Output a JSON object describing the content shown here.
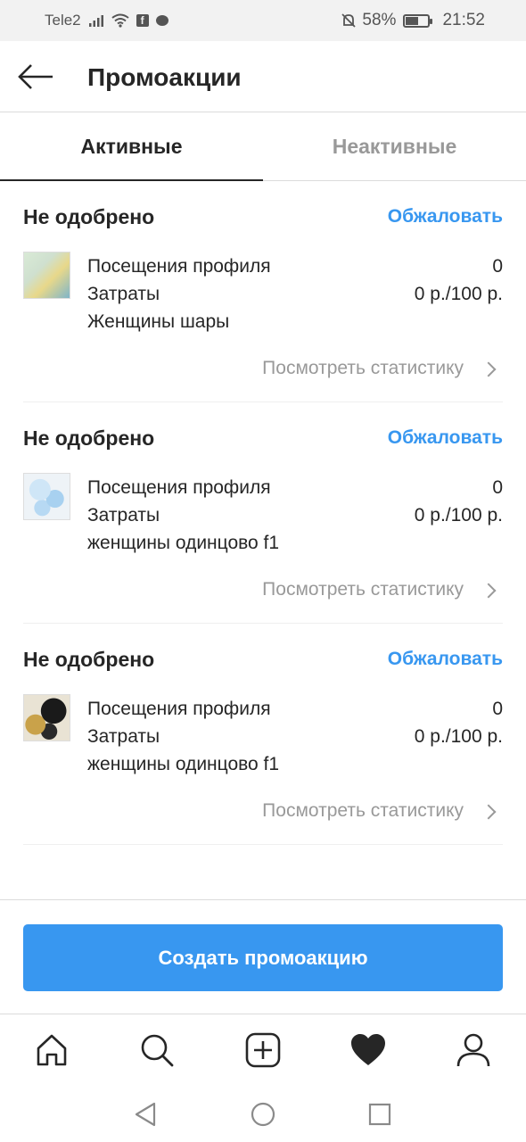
{
  "status_bar": {
    "carrier": "Tele2",
    "fb_badge": "f",
    "battery_percent": "58%",
    "battery_level": 0.58,
    "time": "21:52"
  },
  "header": {
    "title": "Промоакции",
    "back_icon": "arrow-left-icon"
  },
  "tabs": [
    {
      "label": "Активные",
      "active": true
    },
    {
      "label": "Неактивные",
      "active": false
    }
  ],
  "promotions": [
    {
      "status": "Не одобрено",
      "appeal_label": "Обжаловать",
      "metrics": [
        {
          "label": "Посещения профиля",
          "value": "0"
        },
        {
          "label": "Затраты",
          "value": "0 р./100 р."
        }
      ],
      "audience": "Женщины шары",
      "stats_link": "Посмотреть статистику"
    },
    {
      "status": "Не одобрено",
      "appeal_label": "Обжаловать",
      "metrics": [
        {
          "label": "Посещения профиля",
          "value": "0"
        },
        {
          "label": "Затраты",
          "value": "0 р./100 р."
        }
      ],
      "audience": "женщины одинцово f1",
      "stats_link": "Посмотреть статистику"
    },
    {
      "status": "Не одобрено",
      "appeal_label": "Обжаловать",
      "metrics": [
        {
          "label": "Посещения профиля",
          "value": "0"
        },
        {
          "label": "Затраты",
          "value": "0 р./100 р."
        }
      ],
      "audience": "женщины одинцово f1",
      "stats_link": "Посмотреть статистику"
    }
  ],
  "create_button": {
    "label": "Создать промоакцию"
  },
  "colors": {
    "accent": "#3897f0",
    "text_primary": "#262626",
    "text_secondary": "#999999",
    "divider": "#dbdbdb"
  },
  "bottom_nav": [
    {
      "icon": "home-icon"
    },
    {
      "icon": "search-icon"
    },
    {
      "icon": "add-post-icon"
    },
    {
      "icon": "heart-icon"
    },
    {
      "icon": "profile-icon"
    }
  ],
  "system_nav": [
    {
      "icon": "back-triangle-icon"
    },
    {
      "icon": "home-circle-icon"
    },
    {
      "icon": "recents-square-icon"
    }
  ]
}
